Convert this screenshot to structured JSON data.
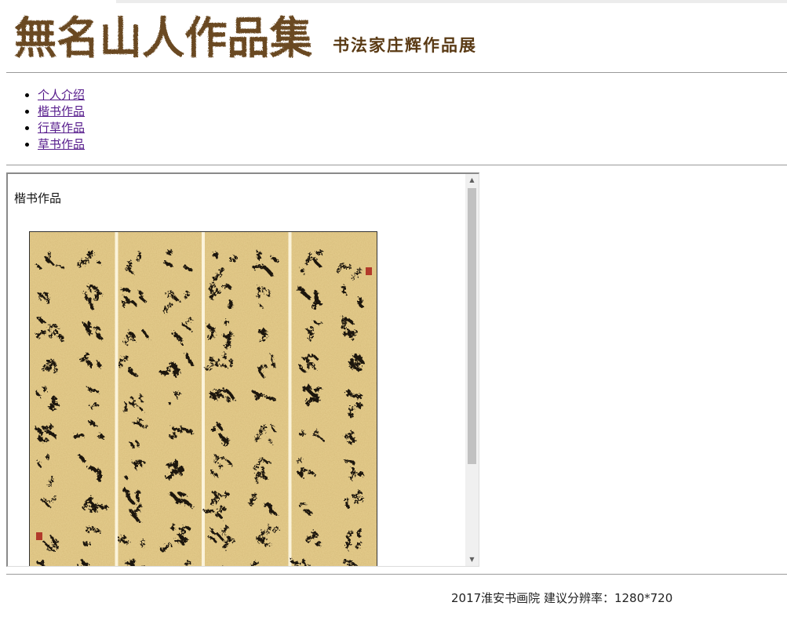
{
  "header": {
    "logo_text": "無名山人作品集",
    "subtitle": "书法家庄辉作品展"
  },
  "nav": {
    "items": [
      {
        "label": "个人介绍"
      },
      {
        "label": "楷书作品"
      },
      {
        "label": "行草作品"
      },
      {
        "label": "草书作品"
      }
    ]
  },
  "content": {
    "heading": "楷书作品",
    "artwork": {
      "kind": "calligraphy-scroll",
      "panels": 4,
      "colors": {
        "paper": "#e7cf8f",
        "ink": "#1c140c",
        "seal": "#b23a2a"
      }
    }
  },
  "footer": {
    "text": "2017淮安书画院 建议分辨率：1280*720"
  },
  "colors": {
    "logo": "#6b4a22",
    "subtitle": "#5a3a14",
    "link": "#551a8b",
    "rule": "#9a9a9a"
  }
}
